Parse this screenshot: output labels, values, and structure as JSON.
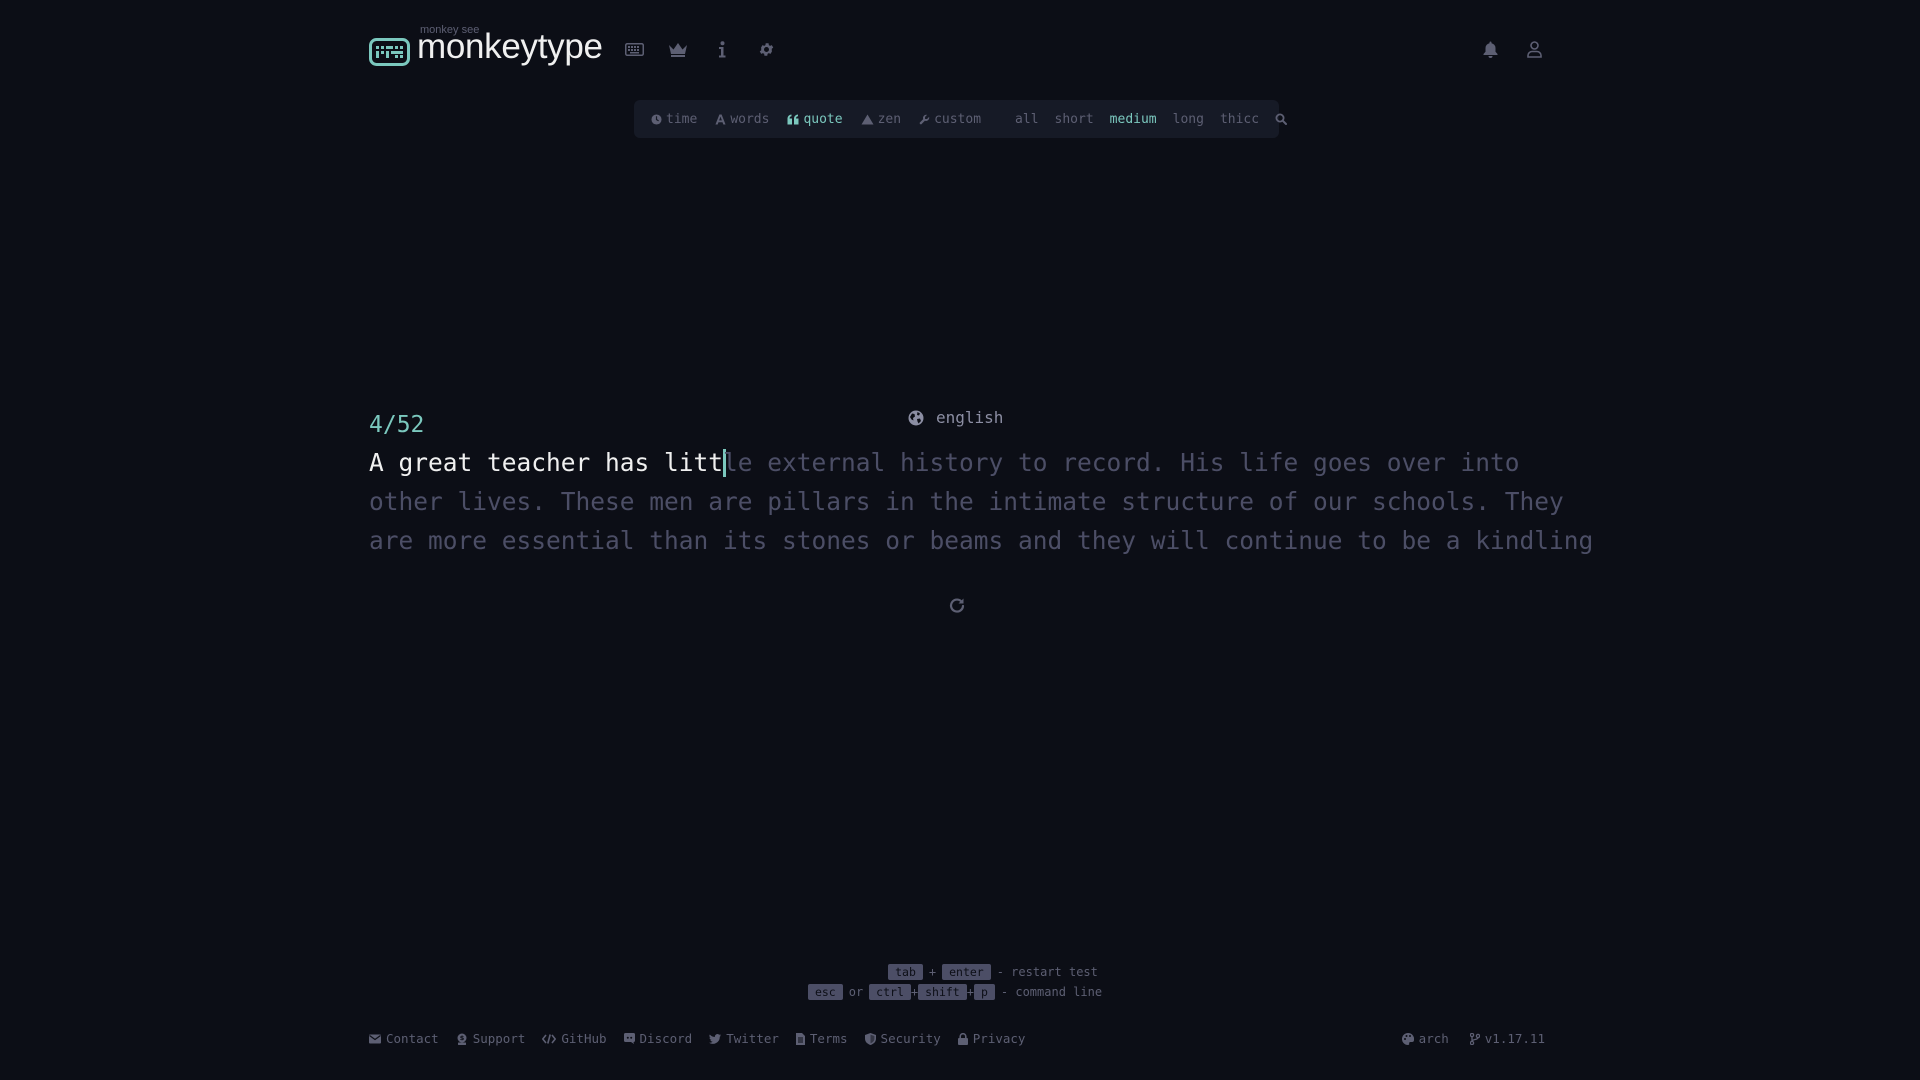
{
  "header": {
    "logo_sub": "monkey see",
    "logo_title": "monkeytype",
    "nav_icons": [
      "keyboard-icon",
      "crown-icon",
      "info-icon",
      "gear-icon"
    ],
    "right_icons": [
      "bell-icon",
      "user-icon"
    ]
  },
  "config": {
    "modes": [
      {
        "label": "time",
        "icon": "clock-icon",
        "active": false
      },
      {
        "label": "words",
        "icon": "font-a-icon",
        "active": false
      },
      {
        "label": "quote",
        "icon": "quote-icon",
        "active": true
      },
      {
        "label": "zen",
        "icon": "mountain-icon",
        "active": false
      },
      {
        "label": "custom",
        "icon": "wrench-icon",
        "active": false
      }
    ],
    "lengths": [
      {
        "label": "all",
        "active": false
      },
      {
        "label": "short",
        "active": false
      },
      {
        "label": "medium",
        "active": true
      },
      {
        "label": "long",
        "active": false
      },
      {
        "label": "thicc",
        "active": false
      }
    ],
    "search_icon": "search-icon"
  },
  "test": {
    "progress": "4/52",
    "language": "english",
    "typed_text": "A great teacher has litt",
    "line1_rest": "le external history to record. His life goes over into",
    "line2": "other lives. These men are pillars in the intimate structure of our schools. They",
    "line3": "are more essential than its stones or beams and they will continue to be a kindling"
  },
  "hints": {
    "line1": {
      "key1": "tab",
      "plus": "+",
      "key2": "enter",
      "text": "- restart test"
    },
    "line2": {
      "key1": "esc",
      "or": "or",
      "key2": "ctrl",
      "plus1": "+",
      "key3": "shift",
      "plus2": "+",
      "key4": "p",
      "text": "- command line"
    }
  },
  "footer": {
    "links": [
      {
        "label": "Contact",
        "icon": "envelope-icon"
      },
      {
        "label": "Support",
        "icon": "donate-icon"
      },
      {
        "label": "GitHub",
        "icon": "code-icon"
      },
      {
        "label": "Discord",
        "icon": "discord-icon"
      },
      {
        "label": "Twitter",
        "icon": "twitter-icon"
      },
      {
        "label": "Terms",
        "icon": "file-icon"
      },
      {
        "label": "Security",
        "icon": "shield-icon"
      },
      {
        "label": "Privacy",
        "icon": "lock-icon"
      }
    ],
    "theme": "arch",
    "version": "v1.17.11"
  },
  "colors": {
    "background": "#0c0e16",
    "accent": "#7bc8be",
    "sub": "#5d5f73",
    "text": "#f0f0f0",
    "untyped": "#4c4e66",
    "panel": "#161a26"
  }
}
